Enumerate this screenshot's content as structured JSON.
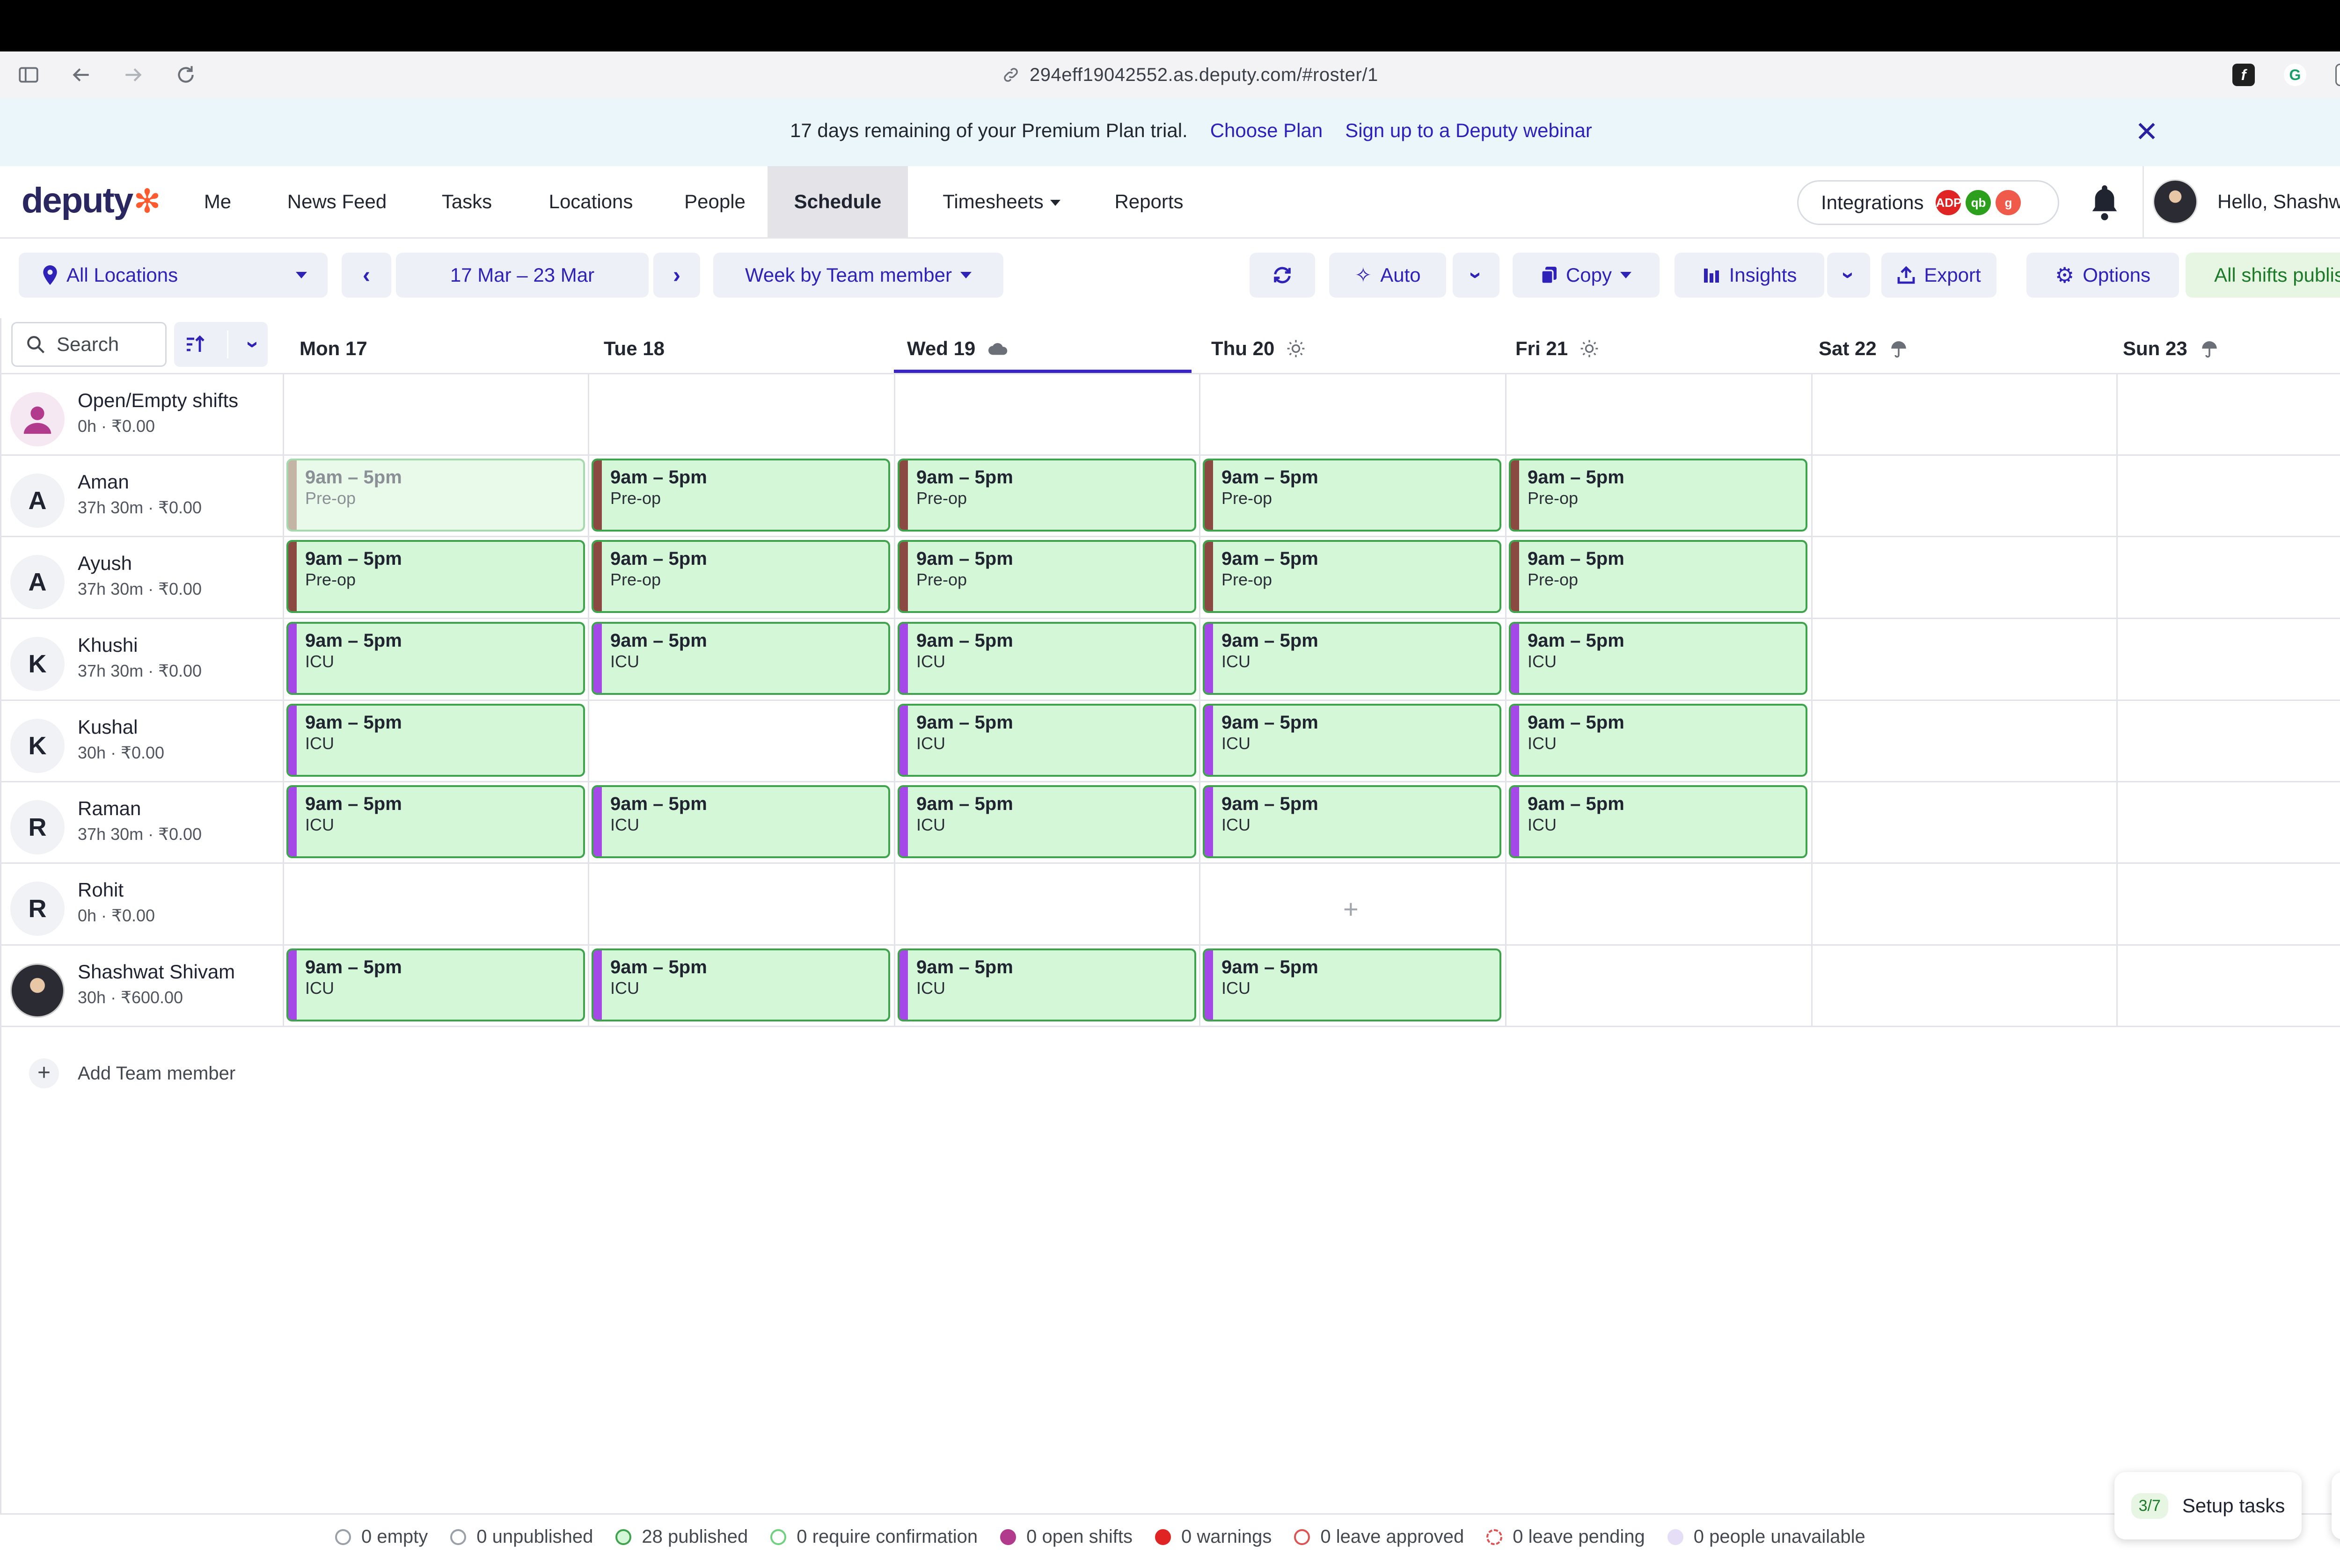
{
  "browser": {
    "url": "294eff19042552.as.deputy.com/#roster/1"
  },
  "banner": {
    "text": "17 days remaining of your Premium Plan trial.",
    "choose_plan": "Choose Plan",
    "webinar": "Sign up to a Deputy webinar",
    "close": "✕"
  },
  "nav": {
    "logo": "deputy",
    "items": [
      "Me",
      "News Feed",
      "Tasks",
      "Locations",
      "People",
      "Schedule",
      "Timesheets",
      "Reports"
    ],
    "active": "Schedule",
    "integrations": "Integrations",
    "integration_badges": [
      "ADP",
      "qb",
      "g"
    ],
    "greeting": "Hello, Shashwat ..."
  },
  "toolbar": {
    "location": "All Locations",
    "date_range": "17 Mar – 23 Mar",
    "view": "Week by Team member",
    "auto": "Auto",
    "copy": "Copy",
    "insights": "Insights",
    "export": "Export",
    "options": "Options",
    "published": "All shifts published"
  },
  "search": {
    "placeholder": "Search"
  },
  "days": [
    {
      "name": "Mon",
      "num": "17",
      "weather": ""
    },
    {
      "name": "Tue",
      "num": "18",
      "weather": ""
    },
    {
      "name": "Wed",
      "num": "19",
      "weather": "cloud-icon"
    },
    {
      "name": "Thu",
      "num": "20",
      "weather": "sun-icon"
    },
    {
      "name": "Fri",
      "num": "21",
      "weather": "sun-icon"
    },
    {
      "name": "Sat",
      "num": "22",
      "weather": "rain-icon"
    },
    {
      "name": "Sun",
      "num": "23",
      "weather": "rain-icon"
    }
  ],
  "people": [
    {
      "name": "Open/Empty shifts",
      "hours": "0h · ₹0.00",
      "initial": "",
      "kind": "open"
    },
    {
      "name": "Aman",
      "hours": "37h 30m · ₹0.00",
      "initial": "A",
      "kind": "initial"
    },
    {
      "name": "Ayush",
      "hours": "37h 30m · ₹0.00",
      "initial": "A",
      "kind": "initial"
    },
    {
      "name": "Khushi",
      "hours": "37h 30m · ₹0.00",
      "initial": "K",
      "kind": "initial"
    },
    {
      "name": "Kushal",
      "hours": "30h · ₹0.00",
      "initial": "K",
      "kind": "initial"
    },
    {
      "name": "Raman",
      "hours": "37h 30m · ₹0.00",
      "initial": "R",
      "kind": "initial"
    },
    {
      "name": "Rohit",
      "hours": "0h · ₹0.00",
      "initial": "R",
      "kind": "initial"
    },
    {
      "name": "Shashwat Shivam",
      "hours": "30h · ₹600.00",
      "initial": "",
      "kind": "photo"
    }
  ],
  "shift_time": "9am – 5pm",
  "shifts": [
    {
      "row": 1,
      "day": 0,
      "role": "Pre-op",
      "faded": true
    },
    {
      "row": 1,
      "day": 1,
      "role": "Pre-op"
    },
    {
      "row": 1,
      "day": 2,
      "role": "Pre-op"
    },
    {
      "row": 1,
      "day": 3,
      "role": "Pre-op"
    },
    {
      "row": 1,
      "day": 4,
      "role": "Pre-op"
    },
    {
      "row": 2,
      "day": 0,
      "role": "Pre-op"
    },
    {
      "row": 2,
      "day": 1,
      "role": "Pre-op"
    },
    {
      "row": 2,
      "day": 2,
      "role": "Pre-op"
    },
    {
      "row": 2,
      "day": 3,
      "role": "Pre-op"
    },
    {
      "row": 2,
      "day": 4,
      "role": "Pre-op"
    },
    {
      "row": 3,
      "day": 0,
      "role": "ICU"
    },
    {
      "row": 3,
      "day": 1,
      "role": "ICU"
    },
    {
      "row": 3,
      "day": 2,
      "role": "ICU"
    },
    {
      "row": 3,
      "day": 3,
      "role": "ICU"
    },
    {
      "row": 3,
      "day": 4,
      "role": "ICU"
    },
    {
      "row": 4,
      "day": 0,
      "role": "ICU"
    },
    {
      "row": 4,
      "day": 2,
      "role": "ICU"
    },
    {
      "row": 4,
      "day": 3,
      "role": "ICU"
    },
    {
      "row": 4,
      "day": 4,
      "role": "ICU"
    },
    {
      "row": 5,
      "day": 0,
      "role": "ICU"
    },
    {
      "row": 5,
      "day": 1,
      "role": "ICU"
    },
    {
      "row": 5,
      "day": 2,
      "role": "ICU"
    },
    {
      "row": 5,
      "day": 3,
      "role": "ICU"
    },
    {
      "row": 5,
      "day": 4,
      "role": "ICU"
    },
    {
      "row": 7,
      "day": 0,
      "role": "ICU"
    },
    {
      "row": 7,
      "day": 1,
      "role": "ICU"
    },
    {
      "row": 7,
      "day": 2,
      "role": "ICU"
    },
    {
      "row": 7,
      "day": 3,
      "role": "ICU"
    }
  ],
  "role_colors": {
    "Pre-op": "#8a4a42",
    "ICU": "#a448e8"
  },
  "add_member": "Add Team member",
  "legend": [
    {
      "label": "0 empty",
      "color": "#ffffff",
      "border": "#9aa0a8",
      "style": "solid"
    },
    {
      "label": "0 unpublished",
      "color": "#ffffff",
      "border": "#9aa0a8",
      "style": "solid"
    },
    {
      "label": "28 published",
      "color": "#d4f7d8",
      "border": "#3fa34d",
      "style": "solid"
    },
    {
      "label": "0 require confirmation",
      "color": "#ffffff",
      "border": "#6fd17b",
      "style": "solid"
    },
    {
      "label": "0 open shifts",
      "color": "#b23a8c",
      "border": "#b23a8c",
      "style": "solid"
    },
    {
      "label": "0 warnings",
      "color": "#e02424",
      "border": "#e02424",
      "style": "solid"
    },
    {
      "label": "0 leave approved",
      "color": "#ffffff",
      "border": "#e05252",
      "style": "solid"
    },
    {
      "label": "0 leave pending",
      "color": "#ffffff",
      "border": "#e05252",
      "style": "dashed"
    },
    {
      "label": "0 people unavailable",
      "color": "#e6def7",
      "border": "#e6def7",
      "style": "solid"
    }
  ],
  "setup": {
    "progress": "3/7",
    "label": "Setup tasks"
  },
  "help": "?"
}
